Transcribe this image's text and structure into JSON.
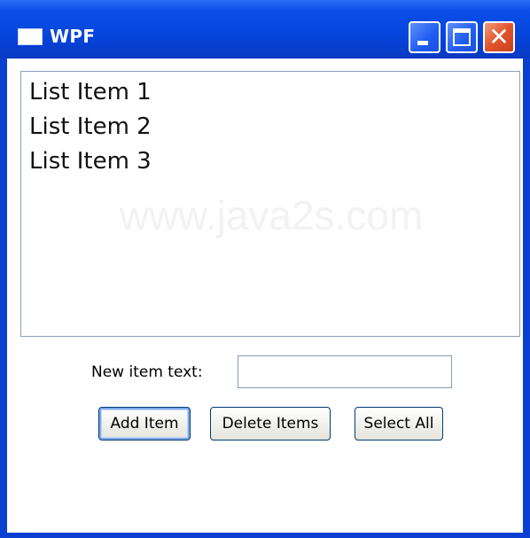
{
  "window": {
    "title": "WPF",
    "icons": {
      "app": "window-icon",
      "minimize": "minimize-icon",
      "maximize": "maximize-icon",
      "close": "close-icon"
    },
    "close_glyph": "✕",
    "colors": {
      "titlebar": "#0649e0",
      "close": "#e0552c",
      "border": "#0a3fd1"
    }
  },
  "listbox": {
    "items": [
      "List Item 1",
      "List Item 2",
      "List Item 3"
    ],
    "watermark": "www.java2s.com"
  },
  "form": {
    "label": "New item text:",
    "input_value": "",
    "input_placeholder": ""
  },
  "buttons": {
    "add": "Add Item",
    "delete": "Delete Items",
    "select_all": "Select All"
  }
}
